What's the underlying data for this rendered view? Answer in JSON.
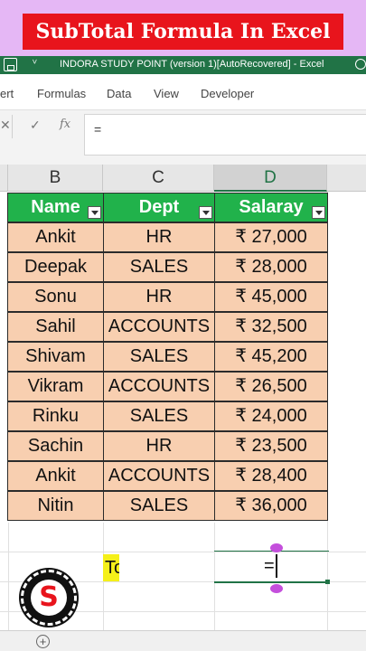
{
  "banner": {
    "title": "SubTotal Formula In Excel"
  },
  "titlebar": {
    "doc_title": "INDORA STUDY POINT (version 1)[AutoRecovered]  -  Excel",
    "qa_glyph": "ⱽ"
  },
  "ribbon": {
    "tabs": [
      "ert",
      "Formulas",
      "Data",
      "View",
      "Developer"
    ]
  },
  "formula_bar": {
    "cancel": "✕",
    "enter": "✓",
    "fx": "fx",
    "content": "="
  },
  "columns": [
    "B",
    "C",
    "D"
  ],
  "table": {
    "headers": [
      "Name",
      "Dept",
      "Salaray"
    ],
    "rows": [
      [
        "Ankit",
        "HR",
        "₹ 27,000"
      ],
      [
        "Deepak",
        "SALES",
        "₹ 28,000"
      ],
      [
        "Sonu",
        "HR",
        "₹ 45,000"
      ],
      [
        "Sahil",
        "ACCOUNTS",
        "₹ 32,500"
      ],
      [
        "Shivam",
        "SALES",
        "₹ 45,200"
      ],
      [
        "Vikram",
        "ACCOUNTS",
        "₹ 26,500"
      ],
      [
        "Rinku",
        "SALES",
        "₹ 24,000"
      ],
      [
        "Sachin",
        "HR",
        "₹ 23,500"
      ],
      [
        "Ankit",
        "ACCOUNTS",
        "₹ 28,400"
      ],
      [
        "Nitin",
        "SALES",
        "₹ 36,000"
      ]
    ]
  },
  "edit": {
    "label_cell": "To",
    "formula_cell": "="
  },
  "logo": {
    "letter": "S"
  },
  "sheetbar": {
    "add_glyph": "+"
  },
  "colors": {
    "excel_green": "#217346",
    "header_green": "#21b24b",
    "row_fill": "#f8cfb0",
    "banner_bg": "#e5b7f5",
    "banner_red": "#e8141c",
    "highlight_yellow": "#f5f019"
  }
}
